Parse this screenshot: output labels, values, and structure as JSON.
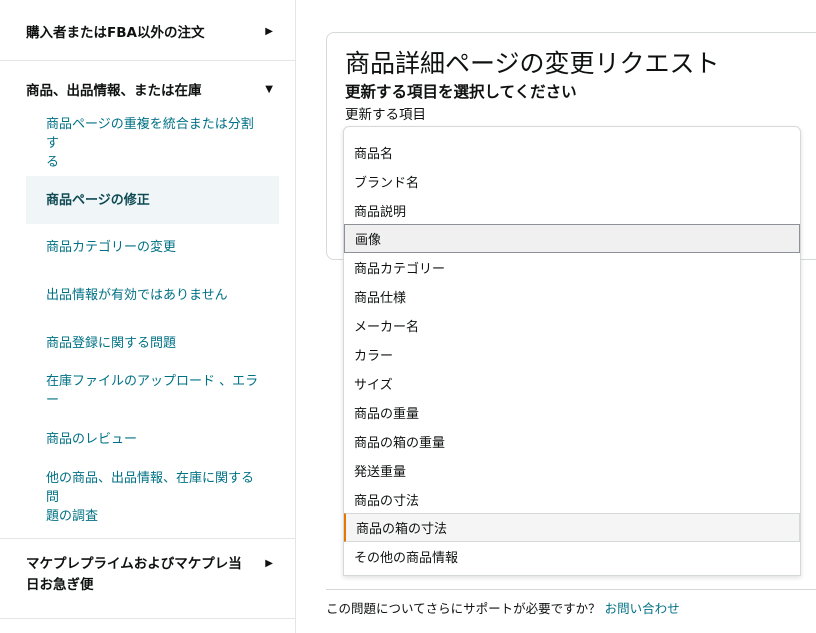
{
  "sidebar": {
    "sections": [
      {
        "label": "購入者またはFBA以外の注文",
        "arrow": "▶"
      },
      {
        "label": "商品、出品情報、または在庫",
        "arrow": "▼"
      },
      {
        "label_line1": "マケプレプライムおよびマケプレ当",
        "label_line2": "日お急ぎ便",
        "arrow": "▶"
      }
    ],
    "items": [
      {
        "line1": "商品ページの重複を統合または分割す",
        "line2": "る"
      },
      {
        "label": "商品ページの修正"
      },
      {
        "label": "商品カテゴリーの変更"
      },
      {
        "label": "出品情報が有効ではありません"
      },
      {
        "label": "商品登録に関する問題"
      },
      {
        "label": "在庫ファイルのアップロード 、エラー"
      },
      {
        "label": "商品のレビュー"
      },
      {
        "line1": "他の商品、出品情報、在庫に関する問",
        "line2": "題の調査"
      }
    ]
  },
  "panel": {
    "title": "商品詳細ページの変更リクエスト",
    "subtitle": "更新する項目を選択してください",
    "field_label": "更新する項目"
  },
  "dropdown": {
    "options": [
      "商品名",
      "ブランド名",
      "商品説明",
      "画像",
      "商品カテゴリー",
      "商品仕様",
      "メーカー名",
      "カラー",
      "サイズ",
      "商品の重量",
      "商品の箱の重量",
      "発送重量",
      "商品の寸法",
      "商品の箱の寸法",
      "その他の商品情報"
    ],
    "hovered_option": "画像",
    "focused_option": "商品の箱の寸法"
  },
  "footer": {
    "text": "この問題についてさらにサポートが必要ですか？",
    "link": "お問い合わせ"
  },
  "colors": {
    "link": "#007185",
    "active_bg": "#f0f6f7",
    "focus_accent": "#e77600"
  }
}
